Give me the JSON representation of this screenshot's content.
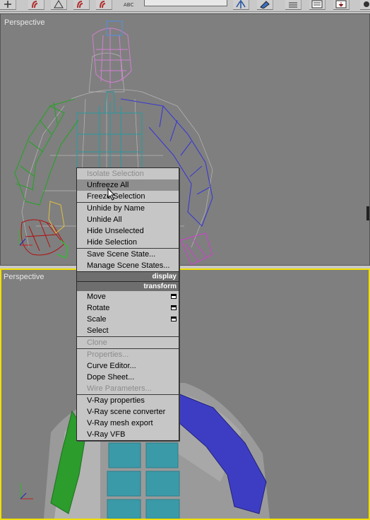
{
  "toolbar": {
    "icons": [
      "select-move-icon",
      "magnet-icon",
      "snap-icon",
      "magnet-angle-icon",
      "snap-percent-icon",
      "spinner-snap-icon",
      "abc-edit-icon",
      "mirror-icon",
      "align-icon",
      "layers-icon",
      "curve-editor-icon",
      "render-setup-icon",
      "teapot-icon"
    ],
    "abc_label": "ABC"
  },
  "viewports": {
    "top": {
      "label": "Perspective",
      "active": false
    },
    "bottom": {
      "label": "Perspective",
      "active": true,
      "border_color": "#f0e000"
    }
  },
  "quad_menu": {
    "tools": [
      {
        "label": "Isolate Selection",
        "disabled": true
      },
      {
        "label": "Unfreeze All",
        "highlighted": true
      },
      {
        "label": "Freeze Selection"
      }
    ],
    "hide_group": [
      {
        "label": "Unhide by Name"
      },
      {
        "label": "Unhide All"
      },
      {
        "label": "Hide Unselected"
      },
      {
        "label": "Hide Selection"
      }
    ],
    "scene_state": [
      {
        "label": "Save Scene State..."
      },
      {
        "label": "Manage Scene States..."
      }
    ],
    "display_header": "display",
    "transform_header": "transform",
    "transform_items": [
      {
        "label": "Move",
        "has_options": true
      },
      {
        "label": "Rotate",
        "has_options": true
      },
      {
        "label": "Scale",
        "has_options": true
      },
      {
        "label": "Select"
      }
    ],
    "clone": {
      "label": "Clone",
      "disabled": true
    },
    "misc": [
      {
        "label": "Properties...",
        "disabled": true
      },
      {
        "label": "Curve Editor..."
      },
      {
        "label": "Dope Sheet..."
      },
      {
        "label": "Wire Parameters...",
        "disabled": true
      }
    ],
    "vray": [
      {
        "label": "V-Ray properties"
      },
      {
        "label": "V-Ray scene converter"
      },
      {
        "label": "V-Ray mesh export"
      },
      {
        "label": "V-Ray VFB"
      }
    ]
  },
  "colors": {
    "viewport_bg": "#7f7f7f",
    "left_arm": "#2a9a2a",
    "right_arm": "#3a3ac8",
    "torso": "#2a9aa0",
    "head": "#d080d0",
    "hand_red": "#b01010"
  }
}
